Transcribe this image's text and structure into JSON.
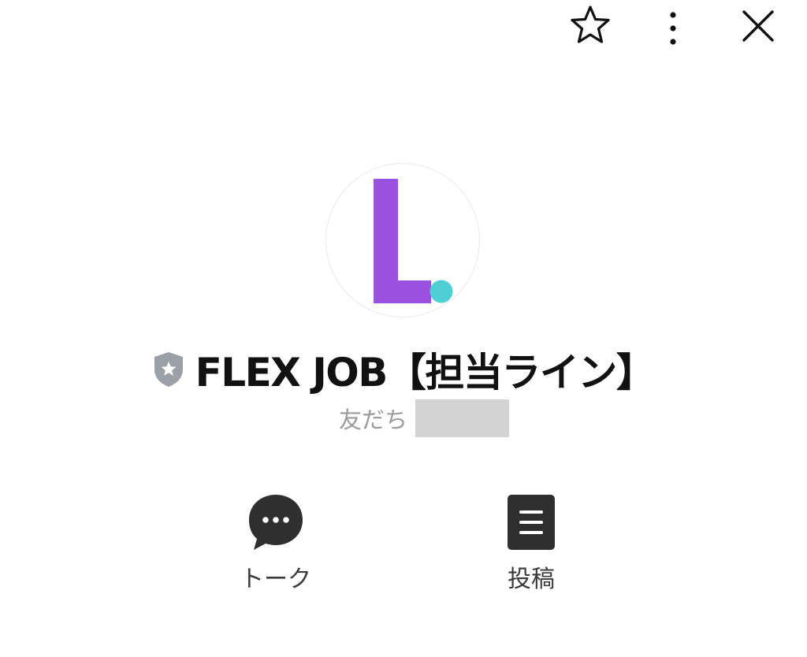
{
  "header": {
    "icons": {
      "favorite": "star-outline-icon",
      "more": "vertical-ellipsis-icon",
      "close": "close-x-icon"
    }
  },
  "profile": {
    "logo_letter": "L",
    "logo_colors": {
      "letter": "#9b51e0",
      "dot": "#4ecfd4"
    },
    "badge_icon": "verified-shield-icon",
    "name": "FLEX JOB【担当ライン】",
    "friends_label": "友だち"
  },
  "actions": [
    {
      "label": "トーク",
      "icon": "chat-bubble-icon"
    },
    {
      "label": "投稿",
      "icon": "post-document-icon"
    }
  ],
  "colors": {
    "icon_dark": "#2f2f2f",
    "subtle_text": "#9b9b9b",
    "badge_gray": "#9aa0a6",
    "redaction": "#d3d3d3"
  }
}
